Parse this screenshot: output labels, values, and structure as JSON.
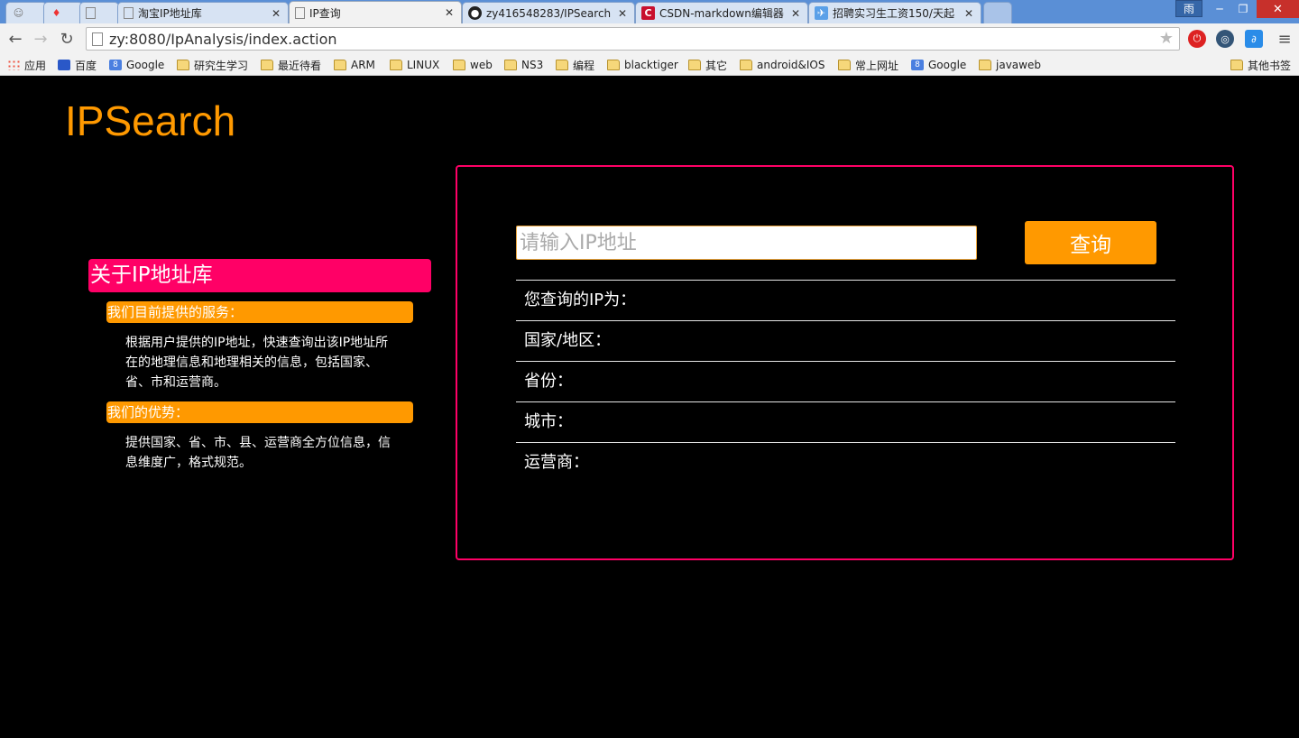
{
  "browser": {
    "tabs": [
      {
        "label": "",
        "icon": "fox-icon"
      },
      {
        "label": "",
        "icon": "flame-icon"
      },
      {
        "label": "",
        "icon": "page-icon"
      },
      {
        "label": "淘宝IP地址库",
        "icon": "page-icon"
      },
      {
        "label": "IP查询",
        "icon": "page-icon",
        "active": true
      },
      {
        "label": "zy416548283/IPSearch",
        "icon": "github-icon"
      },
      {
        "label": "CSDN-markdown编辑器",
        "icon": "csdn-icon"
      },
      {
        "label": "招聘实习生工资150/天起",
        "icon": "bird-icon"
      }
    ],
    "window_badge": "雨",
    "url": "zy:8080/IpAnalysis/index.action",
    "bookmarks": [
      {
        "label": "应用",
        "icon": "apps-icon"
      },
      {
        "label": "百度",
        "icon": "baidu-icon"
      },
      {
        "label": "Google",
        "icon": "google-icon"
      },
      {
        "label": "研究生学习",
        "icon": "folder-icon"
      },
      {
        "label": "最近待看",
        "icon": "folder-icon"
      },
      {
        "label": "ARM",
        "icon": "folder-icon"
      },
      {
        "label": "LINUX",
        "icon": "folder-icon"
      },
      {
        "label": "web",
        "icon": "folder-icon"
      },
      {
        "label": "NS3",
        "icon": "folder-icon"
      },
      {
        "label": "编程",
        "icon": "folder-icon"
      },
      {
        "label": "blacktiger",
        "icon": "folder-icon"
      },
      {
        "label": "其它",
        "icon": "folder-icon"
      },
      {
        "label": "android&IOS",
        "icon": "folder-icon"
      },
      {
        "label": "常上网址",
        "icon": "folder-icon"
      },
      {
        "label": "Google",
        "icon": "google-icon"
      },
      {
        "label": "javaweb",
        "icon": "folder-icon"
      }
    ],
    "other_bookmarks": "其他书签"
  },
  "page": {
    "logo": "IPSearch",
    "about": {
      "title": "关于IP地址库",
      "services_title": "我们目前提供的服务：",
      "services_text": "根据用户提供的IP地址，快速查询出该IP地址所在的地理信息和地理相关的信息，包括国家、省、市和运营商。",
      "advantages_title": "我们的优势：",
      "advantages_text": "提供国家、省、市、县、运营商全方位信息，信息维度广，格式规范。"
    },
    "search": {
      "placeholder": "请输入IP地址",
      "value": "",
      "button": "查询"
    },
    "results": [
      {
        "label": "您查询的IP为："
      },
      {
        "label": "国家/地区："
      },
      {
        "label": "省份："
      },
      {
        "label": "城市："
      },
      {
        "label": "运营商："
      }
    ]
  },
  "colors": {
    "accent_orange": "#ff9900",
    "accent_pink": "#ff0066",
    "background": "#000000"
  }
}
